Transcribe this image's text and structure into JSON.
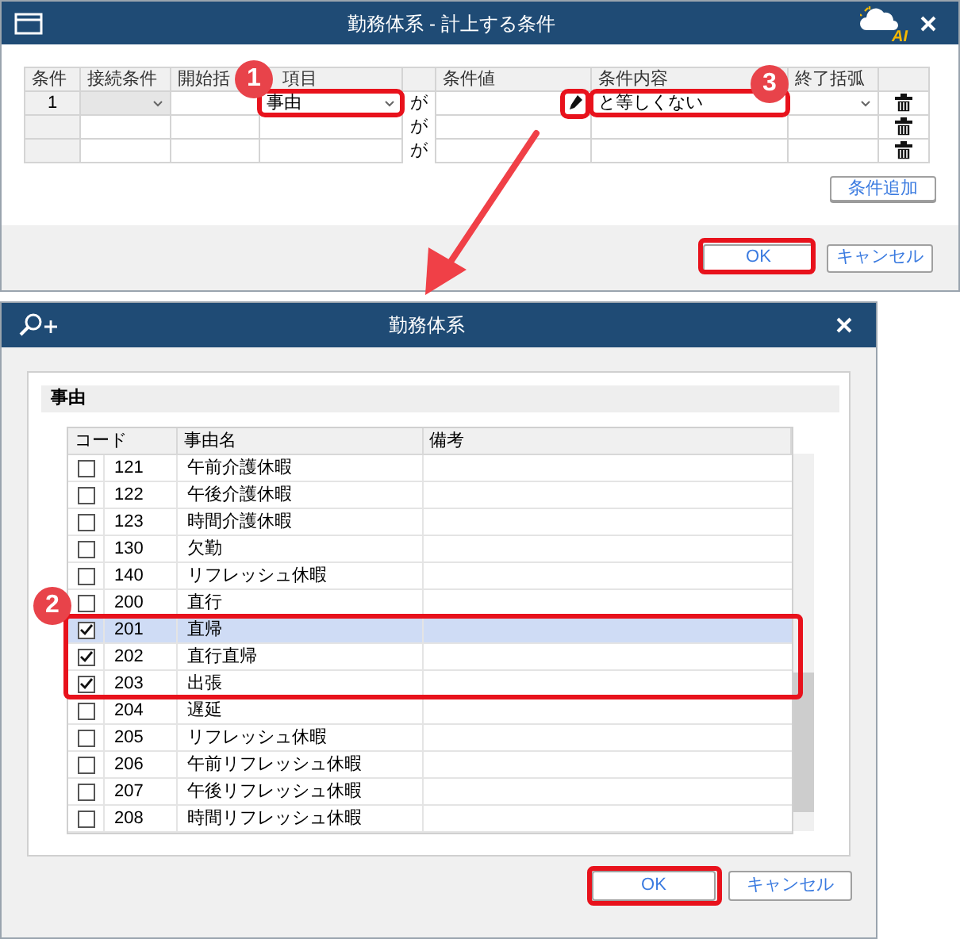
{
  "condition_dialog": {
    "title": "勤務体系 - 計上する条件",
    "logo_text": "AI",
    "columns": [
      "条件",
      "接続条件",
      "開始括",
      "項目",
      "",
      "条件値",
      "条件内容",
      "終了括弧",
      ""
    ],
    "rows": [
      {
        "number": "1",
        "connector_disabled": true,
        "item": "事由",
        "particle": "が",
        "condition": "と等しくない",
        "has_value_editor": true,
        "end_dropdown": true
      },
      {
        "connector_disabled": false,
        "particle": "が",
        "has_value_editor": false,
        "end_dropdown": false
      },
      {
        "connector_disabled": false,
        "particle": "が",
        "has_value_editor": false,
        "end_dropdown": false
      }
    ],
    "add_button": "条件追加",
    "ok_button": "OK",
    "cancel_button": "キャンセル"
  },
  "selection_dialog": {
    "title": "勤務体系",
    "section_title": "事由",
    "columns": [
      "コード",
      "事由名",
      "備考"
    ],
    "rows": [
      {
        "code": "121",
        "name": "午前介護休暇",
        "checked": false,
        "selected": false
      },
      {
        "code": "122",
        "name": "午後介護休暇",
        "checked": false,
        "selected": false
      },
      {
        "code": "123",
        "name": "時間介護休暇",
        "checked": false,
        "selected": false
      },
      {
        "code": "130",
        "name": "欠勤",
        "checked": false,
        "selected": false
      },
      {
        "code": "140",
        "name": "リフレッシュ休暇",
        "checked": false,
        "selected": false
      },
      {
        "code": "200",
        "name": "直行",
        "checked": false,
        "selected": false
      },
      {
        "code": "201",
        "name": "直帰",
        "checked": true,
        "selected": true
      },
      {
        "code": "202",
        "name": "直行直帰",
        "checked": true,
        "selected": false
      },
      {
        "code": "203",
        "name": "出張",
        "checked": true,
        "selected": false
      },
      {
        "code": "204",
        "name": "遅延",
        "checked": false,
        "selected": false
      },
      {
        "code": "205",
        "name": "リフレッシュ休暇",
        "checked": false,
        "selected": false
      },
      {
        "code": "206",
        "name": "午前リフレッシュ休暇",
        "checked": false,
        "selected": false
      },
      {
        "code": "207",
        "name": "午後リフレッシュ休暇",
        "checked": false,
        "selected": false
      },
      {
        "code": "208",
        "name": "時間リフレッシュ休暇",
        "checked": false,
        "selected": false
      }
    ],
    "ok_button": "OK",
    "cancel_button": "キャンセル"
  },
  "callouts": [
    {
      "label": "1"
    },
    {
      "label": "3"
    },
    {
      "label": "2"
    }
  ]
}
